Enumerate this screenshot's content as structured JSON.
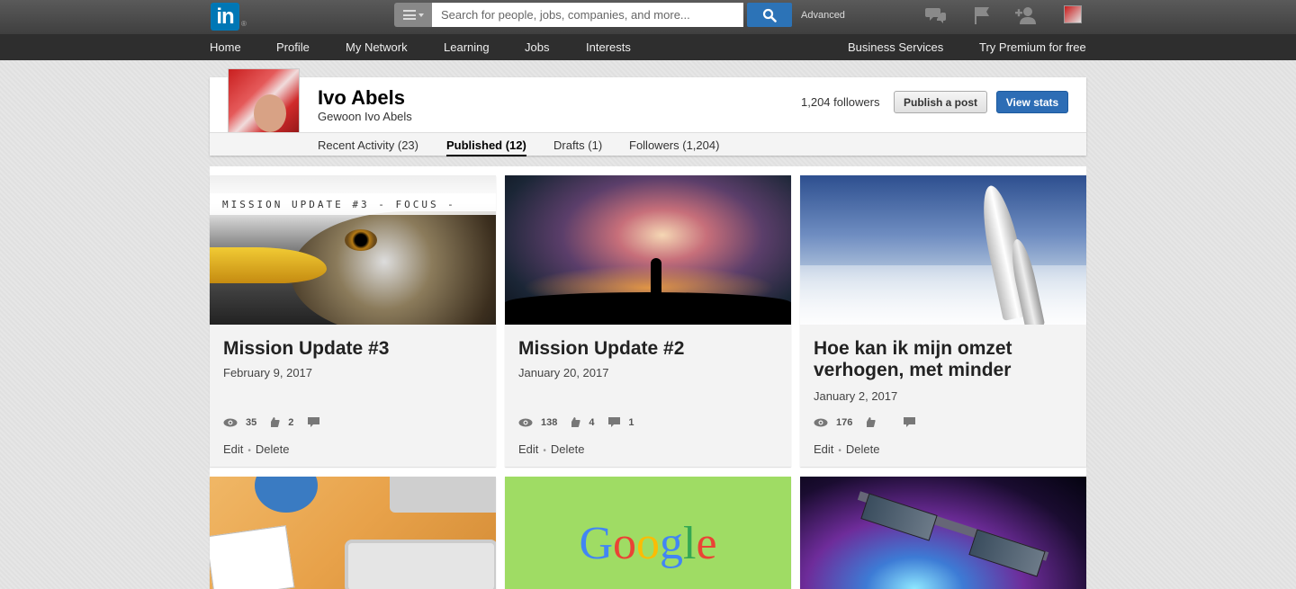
{
  "topbar": {
    "logo_text": "in",
    "logo_reg": "®",
    "search": {
      "placeholder": "Search for people, jobs, companies, and more..."
    },
    "advanced_label": "Advanced",
    "icons": [
      "messages-icon",
      "flag-icon",
      "add-connection-icon",
      "profile-avatar"
    ]
  },
  "nav": {
    "items": [
      {
        "label": "Home"
      },
      {
        "label": "Profile"
      },
      {
        "label": "My Network"
      },
      {
        "label": "Learning"
      },
      {
        "label": "Jobs"
      },
      {
        "label": "Interests"
      }
    ],
    "right": [
      {
        "label": "Business Services"
      },
      {
        "label": "Try Premium for free"
      }
    ]
  },
  "profile": {
    "name": "Ivo Abels",
    "headline": "Gewoon Ivo Abels",
    "followers_text": "1,204 followers",
    "publish_label": "Publish a post",
    "stats_label": "View stats",
    "tabs": [
      {
        "label": "Recent Activity (23)"
      },
      {
        "label": "Published (12)"
      },
      {
        "label": "Drafts (1)"
      },
      {
        "label": "Followers (1,204)"
      }
    ],
    "active_tab": "Published (12)"
  },
  "posts": [
    {
      "title": "Mission Update #3",
      "date": "February 9, 2017",
      "views": "35",
      "likes": "2",
      "comments": "",
      "image_caption": "MISSION UPDATE #3 - FOCUS -",
      "edit": "Edit",
      "delete": "Delete"
    },
    {
      "title": "Mission Update #2",
      "date": "January 20, 2017",
      "views": "138",
      "likes": "4",
      "comments": "1",
      "edit": "Edit",
      "delete": "Delete"
    },
    {
      "title": "Hoe kan ik mijn omzet verhogen, met minder",
      "date": "January 2, 2017",
      "views": "176",
      "likes": "",
      "comments": "",
      "edit": "Edit",
      "delete": "Delete"
    }
  ],
  "google_logo_text": "Google",
  "colors": {
    "brand_blue": "#0077b5",
    "button_blue": "#2d6db5",
    "topbar": "#4a4a4a",
    "navbar": "#2e2e2e"
  }
}
